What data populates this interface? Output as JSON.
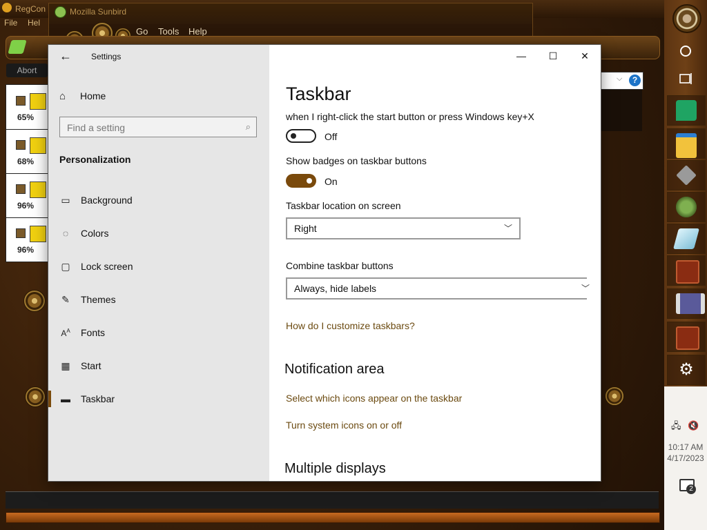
{
  "background_app": {
    "title": "RegCon",
    "menu": [
      "File",
      "Hel"
    ],
    "abort_label": "Abort",
    "rows": [
      {
        "pct": "65%"
      },
      {
        "pct": "68%"
      },
      {
        "pct": "96%"
      },
      {
        "pct": "96%"
      }
    ]
  },
  "sunbird": {
    "title": "Mozilla Sunbird",
    "menu": {
      "go": "Go",
      "tools": "Tools",
      "help": "Help"
    }
  },
  "settings": {
    "window_title": "Settings",
    "sidebar": {
      "home_label": "Home",
      "search_placeholder": "Find a setting",
      "section_title": "Personalization",
      "items": [
        {
          "label": "Background",
          "icon": "image-icon"
        },
        {
          "label": "Colors",
          "icon": "palette-icon"
        },
        {
          "label": "Lock screen",
          "icon": "lock-screen-icon"
        },
        {
          "label": "Themes",
          "icon": "themes-icon"
        },
        {
          "label": "Fonts",
          "icon": "fonts-icon"
        },
        {
          "label": "Start",
          "icon": "start-icon"
        },
        {
          "label": "Taskbar",
          "icon": "taskbar-icon",
          "selected": true
        }
      ]
    },
    "main": {
      "title": "Taskbar",
      "powershell_text": "when I right-click the start button or press Windows key+X",
      "powershell_toggle": {
        "state": "Off"
      },
      "badges_label": "Show badges on taskbar buttons",
      "badges_toggle": {
        "state": "On"
      },
      "location_label": "Taskbar location on screen",
      "location_value": "Right",
      "combine_label": "Combine taskbar buttons",
      "combine_value": "Always, hide labels",
      "customize_link": "How do I customize taskbars?",
      "notification_heading": "Notification area",
      "notif_link1": "Select which icons appear on the taskbar",
      "notif_link2": "Turn system icons on or off",
      "multiple_displays_heading": "Multiple displays"
    }
  },
  "taskbar": {
    "clock_time": "10:17 AM",
    "clock_date": "4/17/2023",
    "notification_count": "2"
  },
  "colors": {
    "accent": "#7a4a0c",
    "link": "#6b4a10",
    "sidebar_bg": "#e6e6e6"
  }
}
